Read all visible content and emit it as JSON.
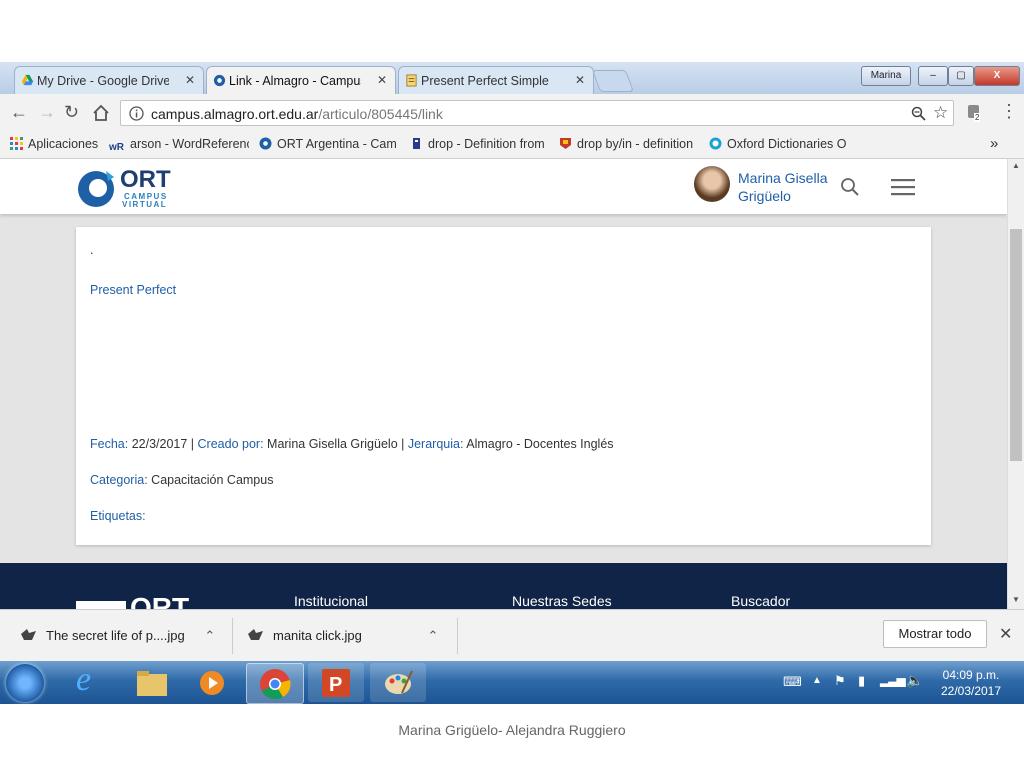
{
  "tabs": [
    {
      "title": "My Drive - Google Drive",
      "icon": "google-drive-icon"
    },
    {
      "title": "Link - Almagro - Campus",
      "icon": "ort-icon",
      "active": true
    },
    {
      "title": "Present Perfect Simple",
      "icon": "document-icon"
    }
  ],
  "window": {
    "profile": "Marina",
    "minimize": "‒",
    "maximize": "▢",
    "close": "X"
  },
  "toolbar": {
    "url_host": "campus.almagro.ort.edu.ar",
    "url_path": "/articulo/805445/link",
    "extensions_badge": "2"
  },
  "bookmarks": [
    {
      "label": "Aplicaciones",
      "icon": "apps-grid-icon"
    },
    {
      "label": "arson - WordReference",
      "icon": "wordreference-icon"
    },
    {
      "label": "ORT Argentina - Campus",
      "icon": "ort-icon"
    },
    {
      "label": "drop - Definition from",
      "icon": "dictionary-icon"
    },
    {
      "label": "drop by/in - definition",
      "icon": "cambridge-icon"
    },
    {
      "label": "Oxford Dictionaries O",
      "icon": "oxford-icon"
    }
  ],
  "bookmarks_overflow": "»",
  "site": {
    "logo_main": "ORT",
    "logo_sub1": "CAMPUS",
    "logo_sub2": "VIRTUAL",
    "user_first": "Marina Gisella",
    "user_last": "Grigüelo"
  },
  "article": {
    "dot": ".",
    "link_text": "Present Perfect",
    "fecha_label": "Fecha:",
    "fecha_value": "22/3/2017",
    "sep": "|",
    "creado_label": "Creado por:",
    "creado_value": "Marina Gisella Grigüelo",
    "jerarquia_label": "Jerarquia:",
    "jerarquia_value": "Almagro - Docentes Inglés",
    "categoria_label": "Categoria:",
    "categoria_value": "Capacitación Campus",
    "etiquetas_label": "Etiquetas:"
  },
  "footer": {
    "logo": "ORT",
    "links": [
      "Institucional",
      "Nuestras Sedes",
      "Buscador"
    ]
  },
  "downloads": {
    "items": [
      "The secret life of p....jpg",
      "manita click.jpg"
    ],
    "show_all": "Mostrar todo"
  },
  "taskbar": {
    "time": "04:09 p.m.",
    "date": "22/03/2017"
  },
  "caption": "Marina Grigüelo- Alejandra Ruggiero"
}
